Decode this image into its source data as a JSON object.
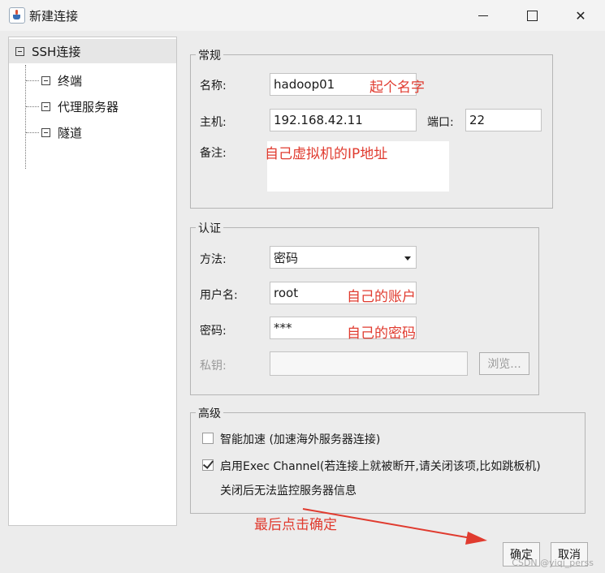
{
  "window": {
    "title": "新建连接"
  },
  "tree": {
    "root": "SSH连接",
    "children": [
      "终端",
      "代理服务器",
      "隧道"
    ]
  },
  "general": {
    "title": "常规",
    "name_label": "名称:",
    "name_value": "hadoop01",
    "host_label": "主机:",
    "host_value": "192.168.42.11",
    "port_label": "端口:",
    "port_value": "22",
    "remark_label": "备注:"
  },
  "auth": {
    "title": "认证",
    "method_label": "方法:",
    "method_value": "密码",
    "user_label": "用户名:",
    "user_value": "root",
    "password_label": "密码:",
    "password_value": "***",
    "key_label": "私钥:",
    "browse_label": "浏览..."
  },
  "advanced": {
    "title": "高级",
    "accelerate_label": "智能加速 (加速海外服务器连接)",
    "accelerate_checked": false,
    "exec_label": "启用Exec Channel(若连接上就被断开,请关闭该项,比如跳板机)",
    "exec_checked": true,
    "exec_note": "关闭后无法监控服务器信息"
  },
  "footer": {
    "ok_label": "确定",
    "cancel_label": "取消"
  },
  "annotations": {
    "name_hint": "起个名字",
    "remark_hint": "自己虚拟机的IP地址",
    "user_hint": "自己的账户",
    "password_hint": "自己的密码",
    "confirm_hint": "最后点击确定",
    "color": "#e03b2f"
  },
  "watermark": "CSDN @yiqi_perss"
}
